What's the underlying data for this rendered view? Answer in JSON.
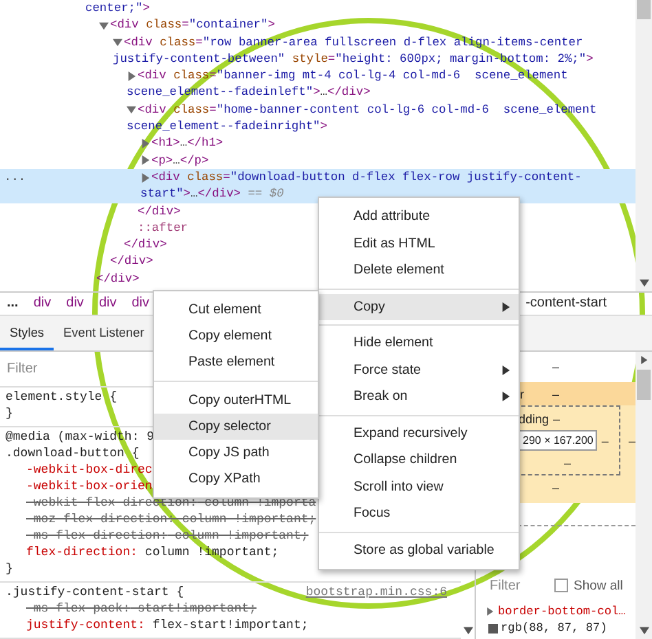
{
  "elements_tree": {
    "nodes": [
      {
        "continued": true,
        "selected": false,
        "lines": [
          [
            {
              "kind": "value",
              "text": "center;\""
            },
            {
              "kind": "tag",
              "text": ">"
            }
          ]
        ],
        "closing": [
          {
            "kind": "tag",
            "text": "</div>"
          }
        ],
        "children": [
          {
            "expanded": true,
            "selected": false,
            "lines": [
              [
                {
                  "kind": "tag",
                  "text": "<div "
                },
                {
                  "kind": "attr",
                  "text": "class"
                },
                {
                  "kind": "tag",
                  "text": "="
                },
                {
                  "kind": "value",
                  "text": "\"container\""
                },
                {
                  "kind": "tag",
                  "text": ">"
                }
              ]
            ],
            "closing": [
              {
                "kind": "tag",
                "text": "</div>"
              }
            ],
            "children": [
              {
                "expanded": true,
                "selected": false,
                "lines": [
                  [
                    {
                      "kind": "tag",
                      "text": "<div "
                    },
                    {
                      "kind": "attr",
                      "text": "class"
                    },
                    {
                      "kind": "tag",
                      "text": "="
                    },
                    {
                      "kind": "value",
                      "text": "\"row banner-area fullscreen d-flex align-items-center"
                    }
                  ],
                  [
                    {
                      "kind": "value",
                      "text": "justify-content-between\" "
                    },
                    {
                      "kind": "attr",
                      "text": "style"
                    },
                    {
                      "kind": "tag",
                      "text": "="
                    },
                    {
                      "kind": "value",
                      "text": "\"height: 600px; margin-bottom: 2%;\""
                    },
                    {
                      "kind": "tag",
                      "text": ">"
                    }
                  ]
                ],
                "closing": [
                  {
                    "kind": "tag",
                    "text": "</div>"
                  }
                ],
                "children": [
                  {
                    "expanded": false,
                    "selected": false,
                    "lines": [
                      [
                        {
                          "kind": "tag",
                          "text": "<div "
                        },
                        {
                          "kind": "attr",
                          "text": "class"
                        },
                        {
                          "kind": "tag",
                          "text": "="
                        },
                        {
                          "kind": "value",
                          "text": "\"banner-img mt-4 col-lg-4 col-md-6  scene_element"
                        }
                      ],
                      [
                        {
                          "kind": "value",
                          "text": "scene_element--fadeinleft\""
                        },
                        {
                          "kind": "tag",
                          "text": ">"
                        },
                        {
                          "kind": "text",
                          "text": "…"
                        },
                        {
                          "kind": "tag",
                          "text": "</div>"
                        }
                      ]
                    ]
                  },
                  {
                    "expanded": true,
                    "selected": false,
                    "lines": [
                      [
                        {
                          "kind": "tag",
                          "text": "<div "
                        },
                        {
                          "kind": "attr",
                          "text": "class"
                        },
                        {
                          "kind": "tag",
                          "text": "="
                        },
                        {
                          "kind": "value",
                          "text": "\"home-banner-content col-lg-6 col-md-6  scene_element"
                        }
                      ],
                      [
                        {
                          "kind": "value",
                          "text": "scene_element--fadeinright\""
                        },
                        {
                          "kind": "tag",
                          "text": ">"
                        }
                      ]
                    ],
                    "closing": [
                      {
                        "kind": "tag",
                        "text": "</div>"
                      }
                    ],
                    "children": [
                      {
                        "expanded": false,
                        "selected": false,
                        "lines": [
                          [
                            {
                              "kind": "tag",
                              "text": "<h1>"
                            },
                            {
                              "kind": "text",
                              "text": "…"
                            },
                            {
                              "kind": "tag",
                              "text": "</h1>"
                            }
                          ]
                        ]
                      },
                      {
                        "expanded": false,
                        "selected": false,
                        "lines": [
                          [
                            {
                              "kind": "tag",
                              "text": "<p>"
                            },
                            {
                              "kind": "text",
                              "text": "…"
                            },
                            {
                              "kind": "tag",
                              "text": "</p>"
                            }
                          ]
                        ]
                      },
                      {
                        "expanded": false,
                        "selected": true,
                        "gutter": "...",
                        "lines": [
                          [
                            {
                              "kind": "tag",
                              "text": "<div "
                            },
                            {
                              "kind": "attr",
                              "text": "class"
                            },
                            {
                              "kind": "tag",
                              "text": "="
                            },
                            {
                              "kind": "value",
                              "text": "\"download-button d-flex flex-row justify-content-"
                            }
                          ],
                          [
                            {
                              "kind": "value",
                              "text": "start\""
                            },
                            {
                              "kind": "tag",
                              "text": ">"
                            },
                            {
                              "kind": "text",
                              "text": "…"
                            },
                            {
                              "kind": "tag",
                              "text": "</div>"
                            },
                            {
                              "kind": "dim",
                              "text": " == $0"
                            }
                          ]
                        ]
                      }
                    ]
                  },
                  {
                    "selected": false,
                    "lines": [
                      [
                        {
                          "kind": "pseudo",
                          "text": "::after"
                        }
                      ]
                    ]
                  }
                ]
              }
            ]
          }
        ]
      }
    ]
  },
  "breadcrumbs": [
    {
      "kind": "ellipsis",
      "text": "..."
    },
    {
      "kind": "tag",
      "text": "div"
    },
    {
      "kind": "tag",
      "text": "div"
    },
    {
      "kind": "tag",
      "text": "div"
    },
    {
      "kind": "tag",
      "text": "div"
    },
    {
      "kind": "text",
      "text": "-content-start"
    }
  ],
  "tabs": [
    {
      "label": "Styles",
      "selected": true
    },
    {
      "label": "Event Listener",
      "selected": false
    }
  ],
  "styles": {
    "filter": {
      "placeholder": "Filter"
    },
    "rules": [
      {
        "selector": "element.style {",
        "close": "}"
      },
      {
        "media": "@media (max-width: 9",
        "selector": ".download-button {",
        "close": "}",
        "declarations": [
          {
            "property": "-webkit-box-direc",
            "overridden": false
          },
          {
            "property": "-webkit-box-orien",
            "overridden": false
          },
          {
            "property": "-webkit-flex-direction:",
            "value": "column !importa",
            "overridden": true
          },
          {
            "property": "-moz-flex-direction:",
            "value": "column !important;",
            "overridden": true
          },
          {
            "property": "-ms-flex-direction:",
            "value": "column !important;",
            "overridden": true
          },
          {
            "property": "flex-direction:",
            "value": "column !important;",
            "overridden": false
          }
        ]
      },
      {
        "selector": ".justify-content-start {",
        "source": "bootstrap.min.css:6",
        "declarations": [
          {
            "property": "-ms-flex-pack:",
            "value": "start!important;",
            "overridden": true
          },
          {
            "property": "justify-content:",
            "value": "flex-start!important;",
            "overridden": false
          }
        ]
      }
    ]
  },
  "box_model": {
    "margin_top": "–",
    "border_label": "r",
    "border_top": "–",
    "padding_label": "dding",
    "padding_top": "–",
    "content": "290 × 167.200",
    "padding_right": "–",
    "border_right": "–",
    "padding_bottom": "–",
    "border_bottom": "–"
  },
  "computed": {
    "filter": {
      "placeholder": "Filter"
    },
    "show_all": {
      "label": "Show all",
      "checked": false
    },
    "properties": [
      {
        "name": "border-bottom-col…",
        "expanded": false,
        "value": "rgb(88, 87, 87)",
        "color": "#585757"
      }
    ]
  },
  "context_menu": {
    "items": [
      {
        "kind": "item",
        "label": "Add attribute",
        "highlighted": false,
        "submenu": false
      },
      {
        "kind": "item",
        "label": "Edit as HTML",
        "highlighted": false,
        "submenu": false
      },
      {
        "kind": "item",
        "label": "Delete element",
        "highlighted": false,
        "submenu": false
      },
      {
        "kind": "separator"
      },
      {
        "kind": "item",
        "label": "Copy",
        "highlighted": true,
        "submenu": true
      },
      {
        "kind": "separator"
      },
      {
        "kind": "item",
        "label": "Hide element",
        "highlighted": false,
        "submenu": false
      },
      {
        "kind": "item",
        "label": "Force state",
        "highlighted": false,
        "submenu": true
      },
      {
        "kind": "item",
        "label": "Break on",
        "highlighted": false,
        "submenu": true
      },
      {
        "kind": "separator"
      },
      {
        "kind": "item",
        "label": "Expand recursively",
        "highlighted": false,
        "submenu": false
      },
      {
        "kind": "item",
        "label": "Collapse children",
        "highlighted": false,
        "submenu": false
      },
      {
        "kind": "item",
        "label": "Scroll into view",
        "highlighted": false,
        "submenu": false
      },
      {
        "kind": "item",
        "label": "Focus",
        "highlighted": false,
        "submenu": false
      },
      {
        "kind": "separator"
      },
      {
        "kind": "item",
        "label": "Store as global variable",
        "highlighted": false,
        "submenu": false
      }
    ]
  },
  "copy_submenu": {
    "items": [
      {
        "kind": "item",
        "label": "Cut element",
        "highlighted": false,
        "submenu": false
      },
      {
        "kind": "item",
        "label": "Copy element",
        "highlighted": false,
        "submenu": false
      },
      {
        "kind": "item",
        "label": "Paste element",
        "highlighted": false,
        "submenu": false
      },
      {
        "kind": "separator"
      },
      {
        "kind": "item",
        "label": "Copy outerHTML",
        "highlighted": false,
        "submenu": false
      },
      {
        "kind": "item",
        "label": "Copy selector",
        "highlighted": true,
        "submenu": false
      },
      {
        "kind": "item",
        "label": "Copy JS path",
        "highlighted": false,
        "submenu": false
      },
      {
        "kind": "item",
        "label": "Copy XPath",
        "highlighted": false,
        "submenu": false
      }
    ]
  }
}
